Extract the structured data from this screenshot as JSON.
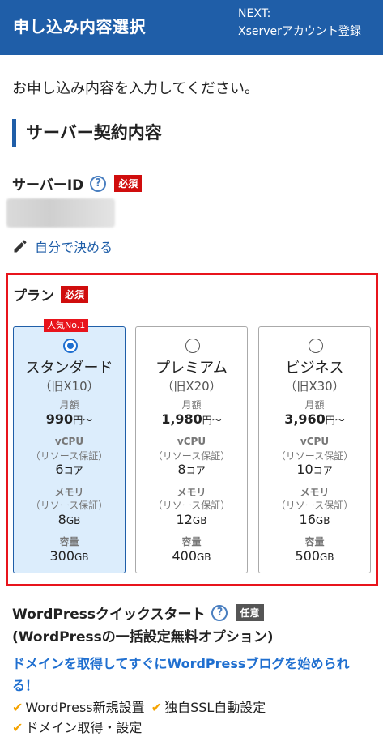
{
  "header": {
    "title": "申し込み内容選択",
    "next_label": "NEXT:",
    "next_step": "Xserverアカウント登録"
  },
  "intro": "お申し込み内容を入力してください。",
  "section_title": "サーバー契約内容",
  "server_id": {
    "label": "サーバーID",
    "help": "?",
    "required_badge": "必須",
    "custom_link": "自分で決める"
  },
  "plan": {
    "label": "プラン",
    "required_badge": "必須",
    "popular_badge": "人気No.1",
    "spec_labels": {
      "price": "月額",
      "vcpu": "vCPU",
      "vcpu_note": "（リソース保証）",
      "memory": "メモリ",
      "memory_note": "（リソース保証）",
      "storage": "容量"
    },
    "items": [
      {
        "name": "スタンダード",
        "old": "（旧X10）",
        "price": "990",
        "price_unit": "円〜",
        "vcpu": "6",
        "vcpu_unit": "コア",
        "memory": "8",
        "memory_unit": "GB",
        "storage": "300",
        "storage_unit": "GB",
        "selected": true
      },
      {
        "name": "プレミアム",
        "old": "（旧X20）",
        "price": "1,980",
        "price_unit": "円〜",
        "vcpu": "8",
        "vcpu_unit": "コア",
        "memory": "12",
        "memory_unit": "GB",
        "storage": "400",
        "storage_unit": "GB",
        "selected": false
      },
      {
        "name": "ビジネス",
        "old": "（旧X30）",
        "price": "3,960",
        "price_unit": "円〜",
        "vcpu": "10",
        "vcpu_unit": "コア",
        "memory": "16",
        "memory_unit": "GB",
        "storage": "500",
        "storage_unit": "GB",
        "selected": false
      }
    ]
  },
  "wordpress": {
    "title": "WordPressクイックスタート",
    "help": "?",
    "optional_badge": "任意",
    "subtitle": "(WordPressの一括設定無料オプション)",
    "description": "ドメインを取得してすぐにWordPressブログを始められる！",
    "features": [
      "WordPress新規設置",
      "独自SSL自動設定",
      "ドメイン取得・設定"
    ]
  },
  "colors": {
    "header_bg": "#1f5ea8",
    "required": "#d00d0d",
    "highlight_border": "#e8141c",
    "selected_bg": "#dcedfc",
    "check": "#f5a300",
    "link": "#1f6fd0"
  }
}
